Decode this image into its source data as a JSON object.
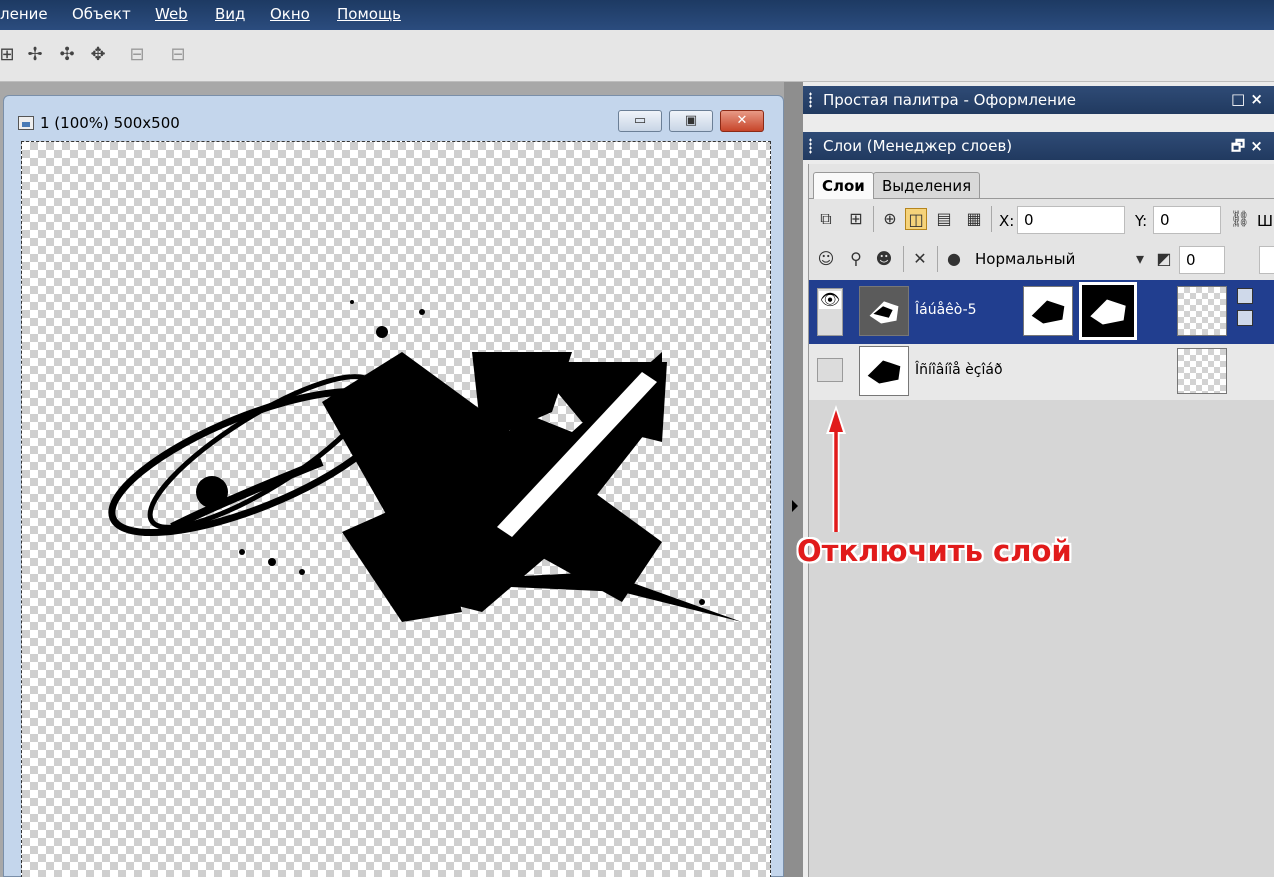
{
  "menu": [
    "ление",
    "Объект",
    "Web",
    "Вид",
    "Окно",
    "Помощь"
  ],
  "toolbar": {
    "icons": [
      "align-top-icon",
      "align-vcenter-icon",
      "align-hcenter-icon",
      "align-center-icon",
      "distribute-h-icon",
      "distribute-v-icon"
    ],
    "glyphs": [
      "⊞",
      "✢",
      "✣",
      "✥",
      "⊟",
      "⊟"
    ]
  },
  "document": {
    "title": "1 (100%) 500x500",
    "minimize_label": "▭",
    "restore_label": "▣",
    "close_label": "✕"
  },
  "palette_panel": {
    "title": "Простая палитра - Оформление",
    "controls": "□ ×"
  },
  "layers_panel": {
    "title": "Слои (Менеджер слоев)",
    "controls": "🗗 ×",
    "tabs": [
      "Слои",
      "Выделения"
    ],
    "x_label": "X:",
    "x_value": "0",
    "y_label": "Y:",
    "y_value": "0",
    "w_label": "Ш",
    "blend_mode": "Нормальный",
    "opacity_value": "0",
    "layers": [
      {
        "name": "Îáúåêò-5",
        "visible": true,
        "selected": true
      },
      {
        "name": "Îñíîâíîå èçîáð",
        "visible": false,
        "selected": false
      }
    ]
  },
  "annotation": {
    "text": "Отключить слой",
    "color": "#e11b1b"
  }
}
